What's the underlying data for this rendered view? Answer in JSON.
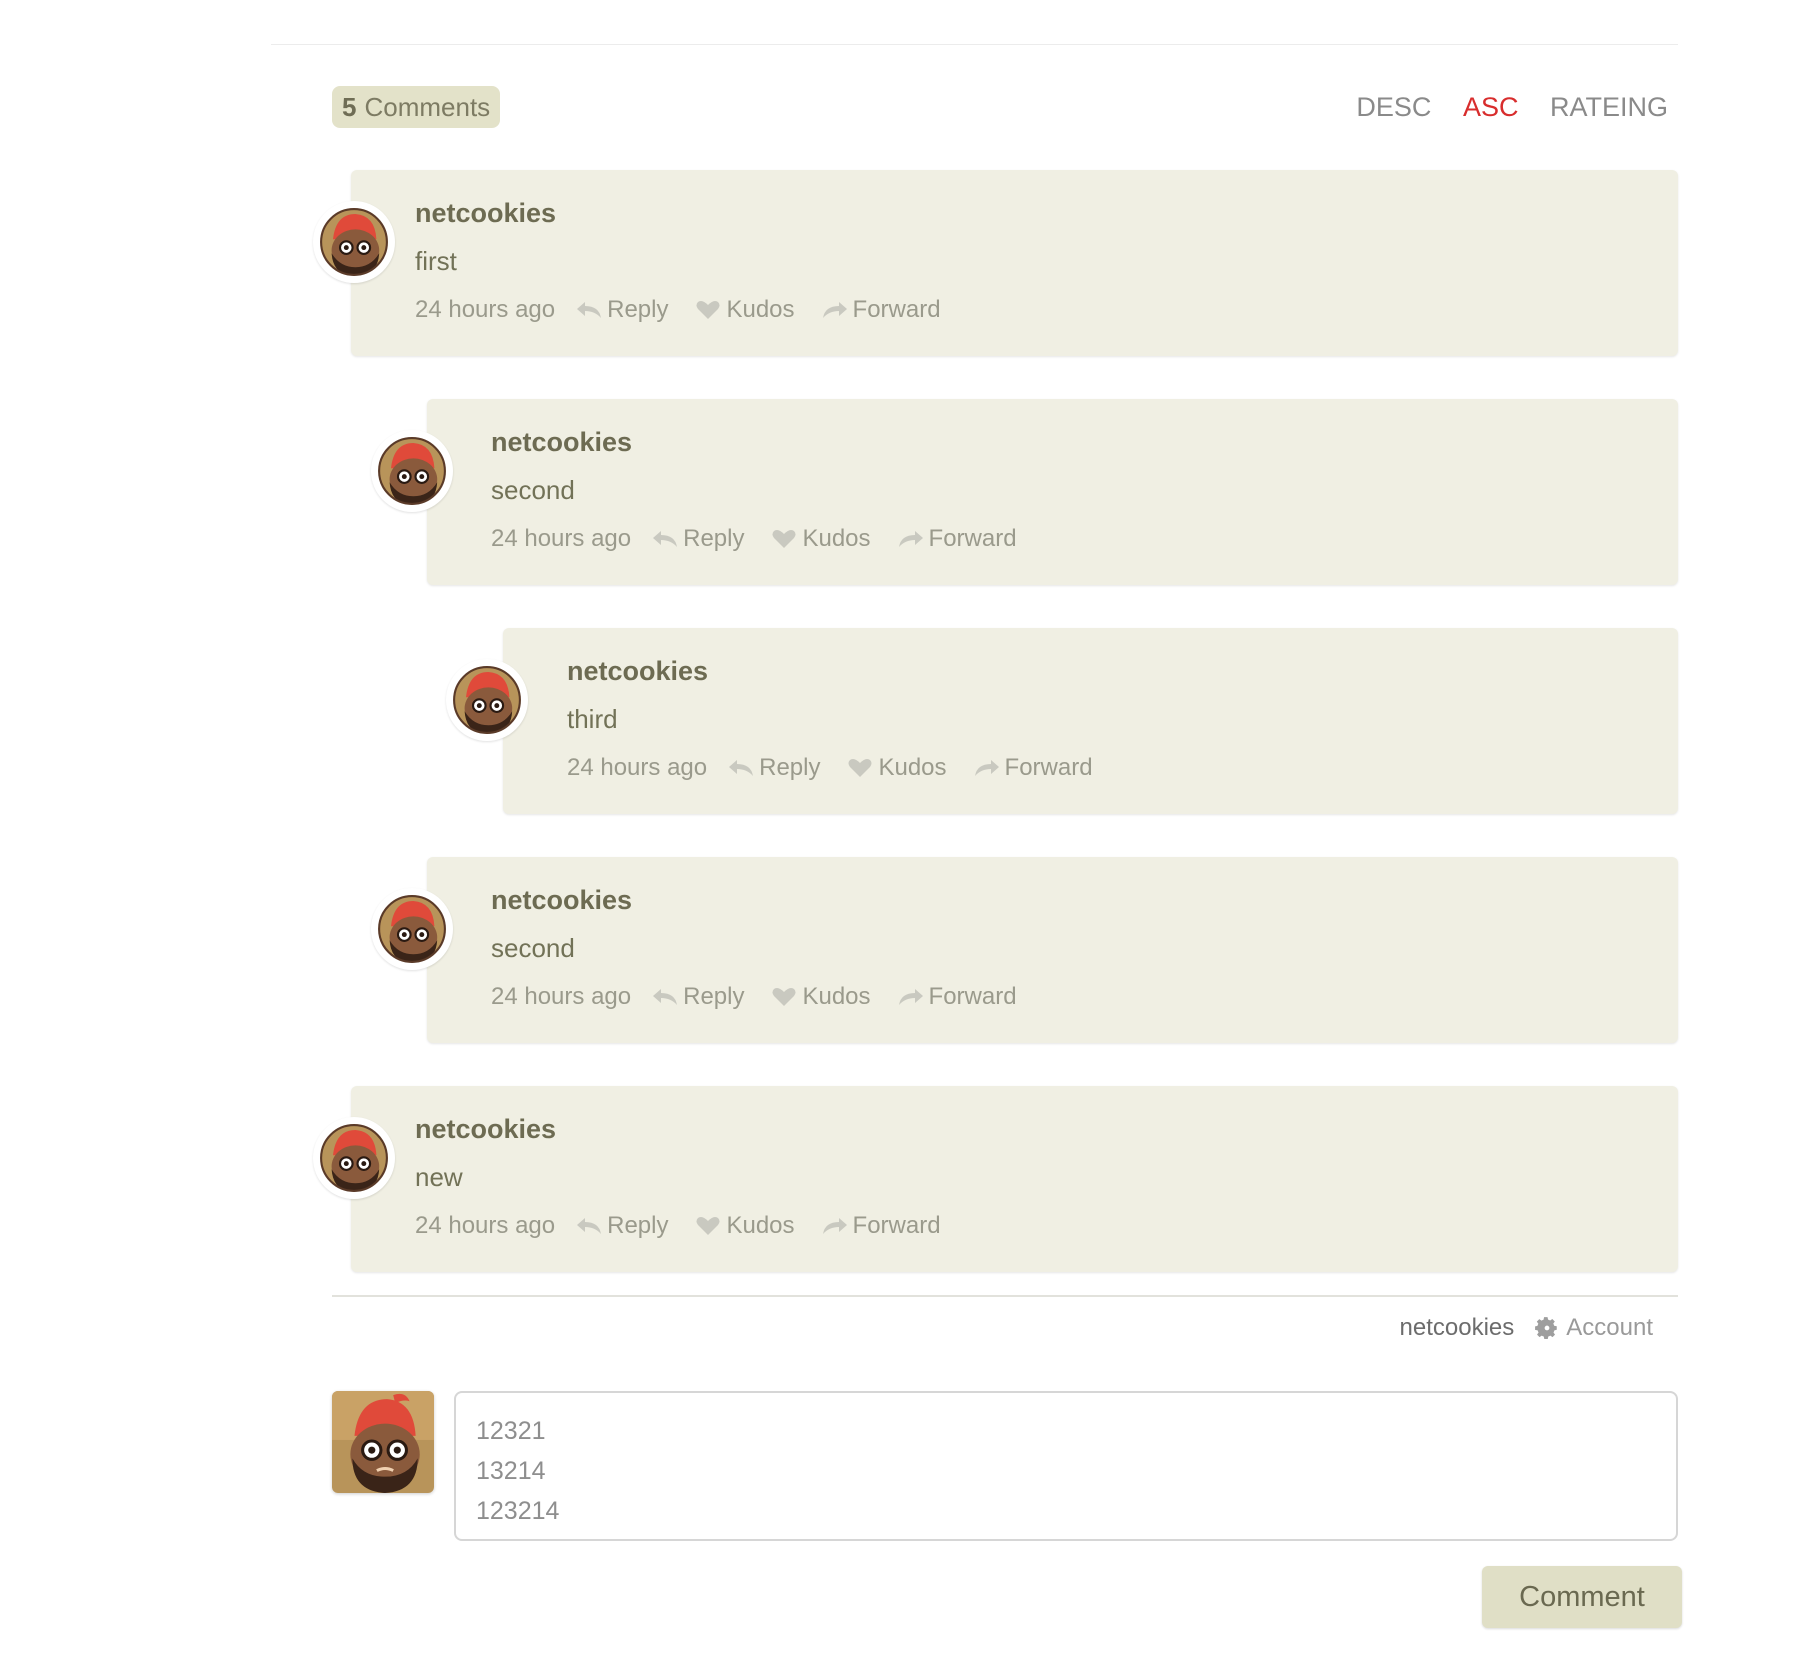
{
  "header": {
    "comment_count": "5",
    "comments_label": "Comments"
  },
  "sort": {
    "options": [
      "DESC",
      "ASC",
      "RATEING"
    ],
    "active": "ASC",
    "active_color": "#d82d2d"
  },
  "comments": [
    {
      "author": "netcookies",
      "text": "first",
      "time": "24 hours ago",
      "reply": "Reply",
      "kudos": "Kudos",
      "forward": "Forward",
      "depth": 0
    },
    {
      "author": "netcookies",
      "text": "second",
      "time": "24 hours ago",
      "reply": "Reply",
      "kudos": "Kudos",
      "forward": "Forward",
      "depth": 1
    },
    {
      "author": "netcookies",
      "text": "third",
      "time": "24 hours ago",
      "reply": "Reply",
      "kudos": "Kudos",
      "forward": "Forward",
      "depth": 2
    },
    {
      "author": "netcookies",
      "text": "second",
      "time": "24 hours ago",
      "reply": "Reply",
      "kudos": "Kudos",
      "forward": "Forward",
      "depth": 1
    },
    {
      "author": "netcookies",
      "text": "new",
      "time": "24 hours ago",
      "reply": "Reply",
      "kudos": "Kudos",
      "forward": "Forward",
      "depth": 0
    }
  ],
  "account": {
    "username": "netcookies",
    "link": "Account"
  },
  "composer": {
    "value": "12321\n13214\n123214",
    "submit_label": "Comment"
  },
  "colors": {
    "card_bg": "#f0efe3",
    "button_bg": "#e0dfc6",
    "accent_red": "#d82d2d"
  }
}
